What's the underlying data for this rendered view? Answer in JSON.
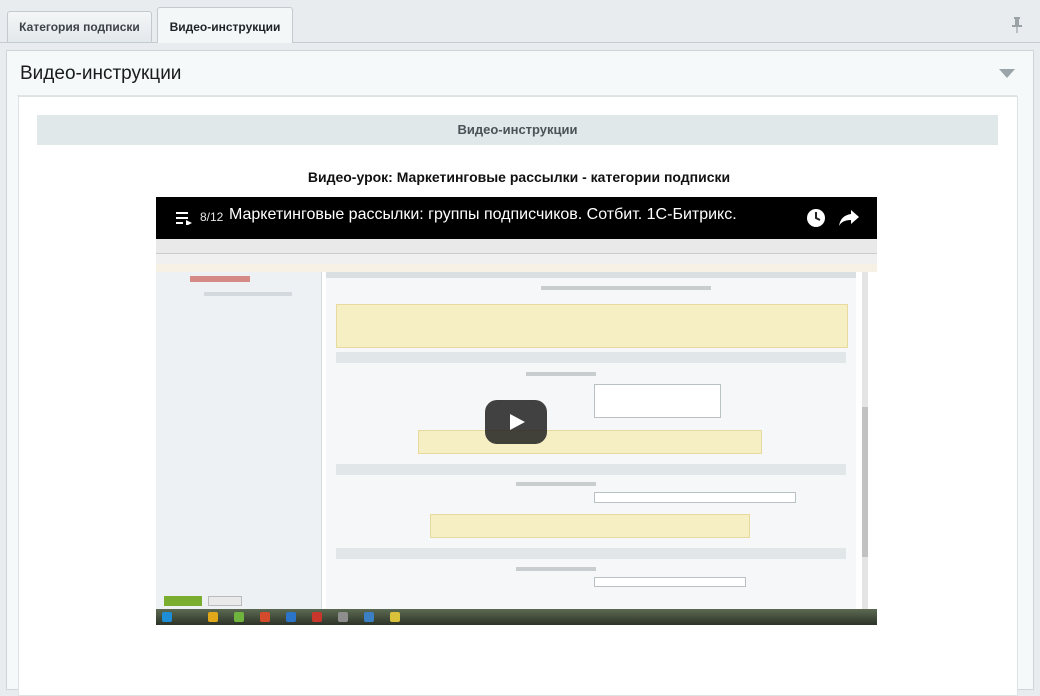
{
  "tabs": [
    {
      "label": "Категория подписки",
      "active": false
    },
    {
      "label": "Видео-инструкции",
      "active": true
    }
  ],
  "icons": {
    "pin": "pin-icon",
    "collapse": "chevron-down-icon",
    "playlist": "playlist-icon",
    "watch_later": "clock-icon",
    "share": "share-icon",
    "play": "play-icon"
  },
  "panel": {
    "title": "Видео-инструкции",
    "section_heading": "Видео-инструкции",
    "lesson_title": "Видео-урок: Маркетинговые рассылки - категории подписки"
  },
  "video": {
    "playlist_position": "8/12",
    "title": "Маркетинговые рассылки: группы подписчиков. Сотбит. 1С-Битрикс."
  },
  "colors": {
    "accent_green": "#7aae2e",
    "youtube_play_bg": "#212121",
    "section_head_bg": "#e0e8ea"
  }
}
